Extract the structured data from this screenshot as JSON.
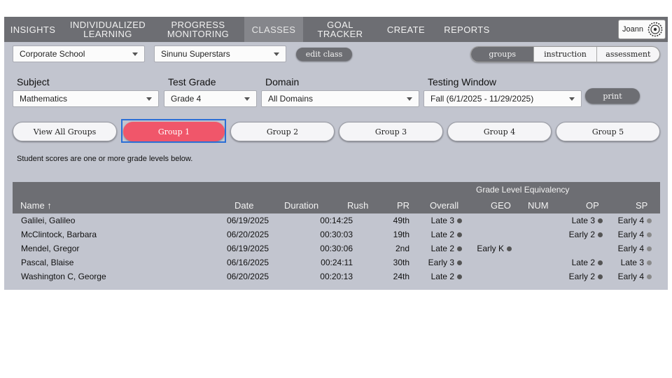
{
  "nav": {
    "items": [
      {
        "label": "INSIGHTS"
      },
      {
        "label": "INDIVIDUALIZED\nLEARNING"
      },
      {
        "label": "PROGRESS\nMONITORING"
      },
      {
        "label": "CLASSES"
      },
      {
        "label": "GOAL TRACKER"
      },
      {
        "label": "CREATE"
      },
      {
        "label": "REPORTS"
      }
    ],
    "active": "CLASSES",
    "user_name": "Joann"
  },
  "class_bar": {
    "school": "Corporate School",
    "class_name": "Sinunu Superstars",
    "edit_label": "edit class",
    "views": [
      "groups",
      "instruction",
      "assessment"
    ],
    "active_view": "groups"
  },
  "filters": {
    "subject": {
      "label": "Subject",
      "value": "Mathematics"
    },
    "test_grade": {
      "label": "Test Grade",
      "value": "Grade 4"
    },
    "domain": {
      "label": "Domain",
      "value": "All Domains"
    },
    "testing_window": {
      "label": "Testing Window",
      "value": "Fall (6/1/2025 - 11/29/2025)"
    },
    "print_label": "print"
  },
  "groups": {
    "tabs": [
      "View All Groups",
      "Group 1",
      "Group 2",
      "Group 3",
      "Group 4",
      "Group 5"
    ],
    "active": "Group 1"
  },
  "note": "Student scores are one or more grade levels below.",
  "table": {
    "group_header": "Grade Level Equivalency",
    "headers": {
      "name": "Name ↑",
      "date": "Date",
      "duration": "Duration",
      "rush": "Rush",
      "pr": "PR",
      "overall": "Overall",
      "geo": "GEO",
      "num": "NUM",
      "op": "OP",
      "sp": "SP"
    },
    "rows": [
      {
        "name": "Galilei, Galileo",
        "date": "06/19/2025",
        "duration": "00:14:25",
        "rush": "",
        "pr": "49th",
        "overall": "Late 3",
        "geo": "",
        "num": "",
        "op": "Late 3",
        "sp": "Early 4"
      },
      {
        "name": "McClintock, Barbara",
        "date": "06/20/2025",
        "duration": "00:30:03",
        "rush": "",
        "pr": "19th",
        "overall": "Late 2",
        "geo": "",
        "num": "",
        "op": "Early 2",
        "sp": "Early 4"
      },
      {
        "name": "Mendel, Gregor",
        "date": "06/19/2025",
        "duration": "00:30:06",
        "rush": "",
        "pr": "2nd",
        "overall": "Late 2",
        "geo": "Early K",
        "num": "",
        "op": "",
        "sp": "Early 4"
      },
      {
        "name": "Pascal, Blaise",
        "date": "06/16/2025",
        "duration": "00:24:11",
        "rush": "",
        "pr": "30th",
        "overall": "Early 3",
        "geo": "",
        "num": "",
        "op": "Late 2",
        "sp": "Late 3"
      },
      {
        "name": "Washington C, George",
        "date": "06/20/2025",
        "duration": "00:20:13",
        "rush": "",
        "pr": "24th",
        "overall": "Late 2",
        "geo": "",
        "num": "",
        "op": "Early 2",
        "sp": "Early 4"
      }
    ]
  },
  "colors": {
    "nav_bg": "#6d6e73",
    "page_bg": "#c2c5cf",
    "active_group": "#f0566a",
    "focus_ring": "#2b6fd6",
    "dot_dark": "#555555",
    "dot_light": "#8a8a8a"
  }
}
